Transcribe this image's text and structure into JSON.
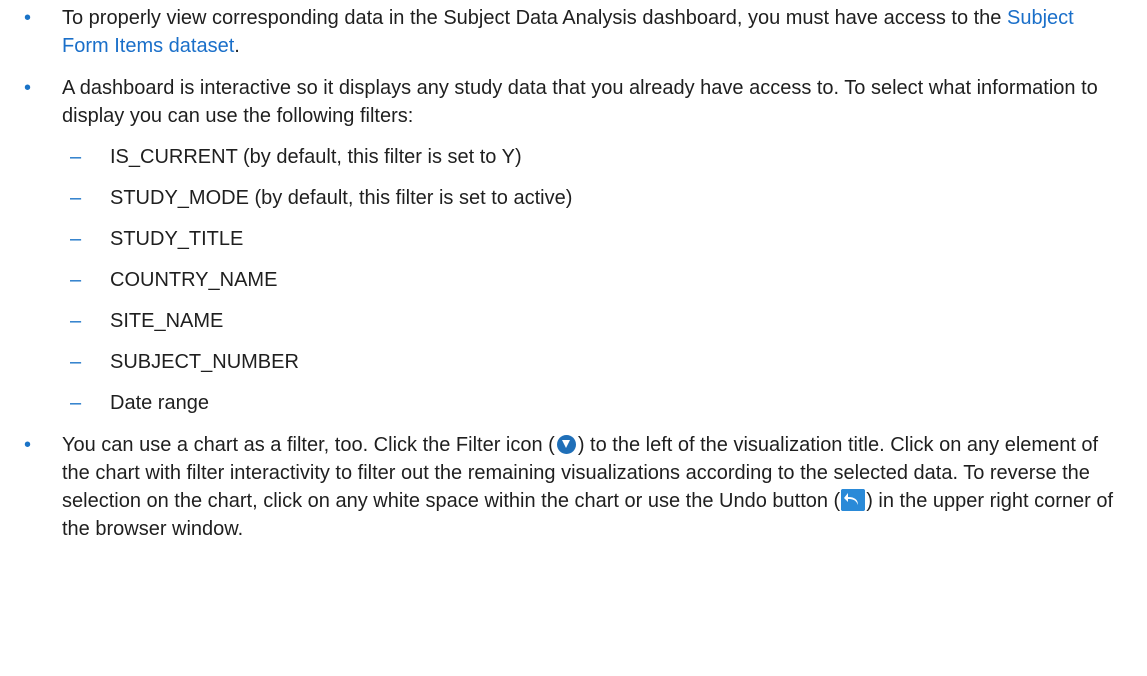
{
  "bullets": [
    {
      "text_before": "To properly view corresponding data in the Subject Data Analysis dashboard, you must have access to the ",
      "link_text": "Subject Form Items dataset",
      "text_after": "."
    },
    {
      "text": "A dashboard is interactive so it displays any study data that you already have access to. To select what information to display you can use the following filters:",
      "filters": [
        "IS_CURRENT (by default, this filter is set to Y)",
        "STUDY_MODE (by default, this filter is set to active)",
        "STUDY_TITLE",
        "COUNTRY_NAME",
        "SITE_NAME",
        "SUBJECT_NUMBER",
        "Date range"
      ]
    },
    {
      "part1": "You can use a chart as a filter, too. Click the Filter icon (",
      "part2": ") to the left of the visualization title. Click on any element of the chart with filter interactivity to filter out the remaining visualizations according to the selected data. To reverse the selection on the chart, click on any white space within the chart or use the Undo button (",
      "part3": ") in the upper right corner of the browser window."
    }
  ],
  "marks": {
    "bullet": "•",
    "dash": "–"
  },
  "icons": {
    "filter": "filter-icon",
    "undo": "undo-icon"
  },
  "colors": {
    "accent": "#1a73c7",
    "link": "#1a6fc9",
    "text": "#1f1f1f"
  }
}
